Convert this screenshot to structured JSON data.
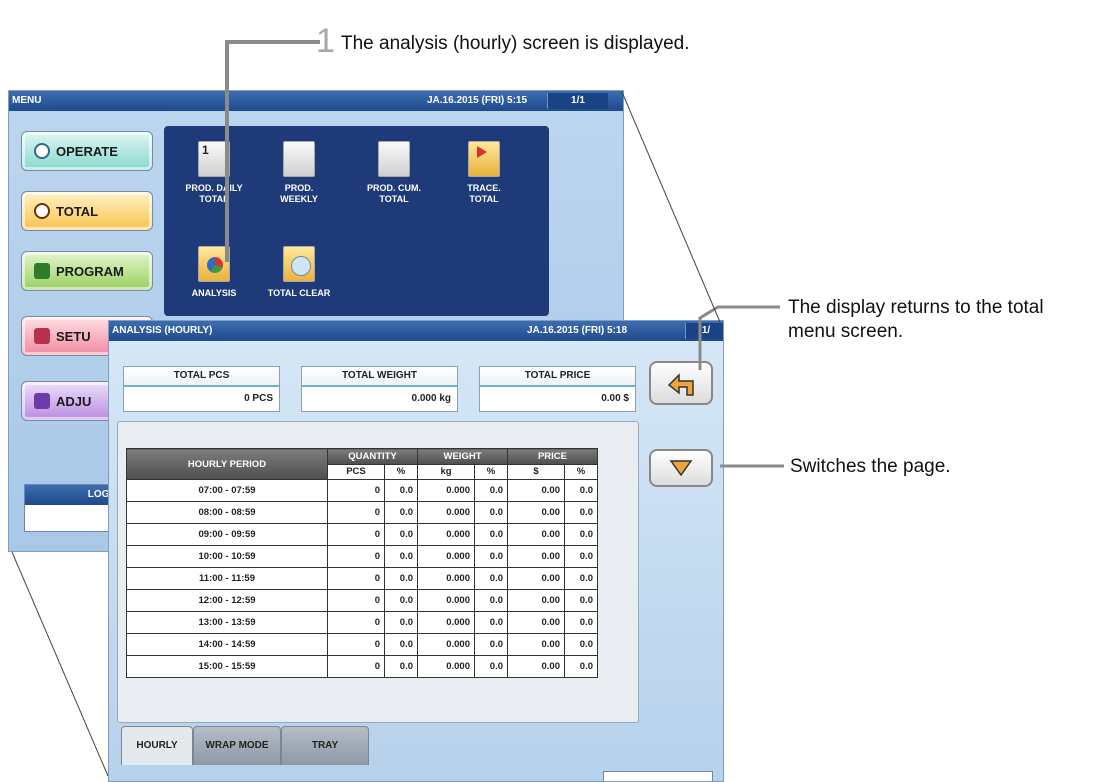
{
  "callouts": {
    "step_number": "1",
    "step_text": "The analysis (hourly) screen is displayed.",
    "return_text_line1": "The display returns to the total",
    "return_text_line2": "menu screen.",
    "page_text": "Switches the page."
  },
  "menu_screen": {
    "title": "MENU",
    "datetime": "JA.16.2015 (FRI)  5:15",
    "page": "1/1",
    "buttons": [
      {
        "label": "OPERATE"
      },
      {
        "label": "TOTAL"
      },
      {
        "label": "PROGRAM"
      },
      {
        "label": "SETU"
      },
      {
        "label": "ADJU"
      }
    ],
    "icons": [
      {
        "line1": "PROD. DAILY",
        "line2": "TOTAL",
        "icon": "daily-report-icon"
      },
      {
        "line1": "PROD.",
        "line2": "WEEKLY",
        "icon": "weekly-report-icon"
      },
      {
        "line1": "PROD. CUM.",
        "line2": "TOTAL",
        "icon": "cumulative-report-icon"
      },
      {
        "line1": "TRACE.",
        "line2": "TOTAL",
        "icon": "trace-map-icon"
      },
      {
        "line1": "ANALYSIS",
        "line2": "",
        "icon": "pie-chart-icon"
      },
      {
        "line1": "TOTAL CLEAR",
        "line2": "",
        "icon": "clear-disc-icon"
      }
    ],
    "login_label": "LOGI"
  },
  "analysis_screen": {
    "title": "ANALYSIS (HOURLY)",
    "datetime": "JA.16.2015 (FRI)  5:18",
    "page": "1/",
    "totals": {
      "pcs_label": "TOTAL PCS",
      "pcs_value": "0 PCS",
      "weight_label": "TOTAL WEIGHT",
      "weight_value": "0.000 kg",
      "price_label": "TOTAL PRICE",
      "price_value": "0.00 $"
    },
    "headers": {
      "period": "HOURLY PERIOD",
      "quantity": "QUANTITY",
      "weight": "WEIGHT",
      "price": "PRICE",
      "pcs": "PCS",
      "pct": "%",
      "kg": "kg",
      "dollar": "$"
    },
    "rows": [
      {
        "period": "07:00 - 07:59",
        "pcs": "0",
        "pcs_pct": "0.0",
        "kg": "0.000",
        "kg_pct": "0.0",
        "price": "0.00",
        "price_pct": "0.0"
      },
      {
        "period": "08:00 - 08:59",
        "pcs": "0",
        "pcs_pct": "0.0",
        "kg": "0.000",
        "kg_pct": "0.0",
        "price": "0.00",
        "price_pct": "0.0"
      },
      {
        "period": "09:00 - 09:59",
        "pcs": "0",
        "pcs_pct": "0.0",
        "kg": "0.000",
        "kg_pct": "0.0",
        "price": "0.00",
        "price_pct": "0.0"
      },
      {
        "period": "10:00 - 10:59",
        "pcs": "0",
        "pcs_pct": "0.0",
        "kg": "0.000",
        "kg_pct": "0.0",
        "price": "0.00",
        "price_pct": "0.0"
      },
      {
        "period": "11:00 - 11:59",
        "pcs": "0",
        "pcs_pct": "0.0",
        "kg": "0.000",
        "kg_pct": "0.0",
        "price": "0.00",
        "price_pct": "0.0"
      },
      {
        "period": "12:00 - 12:59",
        "pcs": "0",
        "pcs_pct": "0.0",
        "kg": "0.000",
        "kg_pct": "0.0",
        "price": "0.00",
        "price_pct": "0.0"
      },
      {
        "period": "13:00 - 13:59",
        "pcs": "0",
        "pcs_pct": "0.0",
        "kg": "0.000",
        "kg_pct": "0.0",
        "price": "0.00",
        "price_pct": "0.0"
      },
      {
        "period": "14:00 - 14:59",
        "pcs": "0",
        "pcs_pct": "0.0",
        "kg": "0.000",
        "kg_pct": "0.0",
        "price": "0.00",
        "price_pct": "0.0"
      },
      {
        "period": "15:00 - 15:59",
        "pcs": "0",
        "pcs_pct": "0.0",
        "kg": "0.000",
        "kg_pct": "0.0",
        "price": "0.00",
        "price_pct": "0.0"
      }
    ],
    "tabs": [
      {
        "label": "HOURLY",
        "active": true
      },
      {
        "label": "WRAP MODE",
        "active": false
      },
      {
        "label": "TRAY",
        "active": false
      }
    ]
  }
}
